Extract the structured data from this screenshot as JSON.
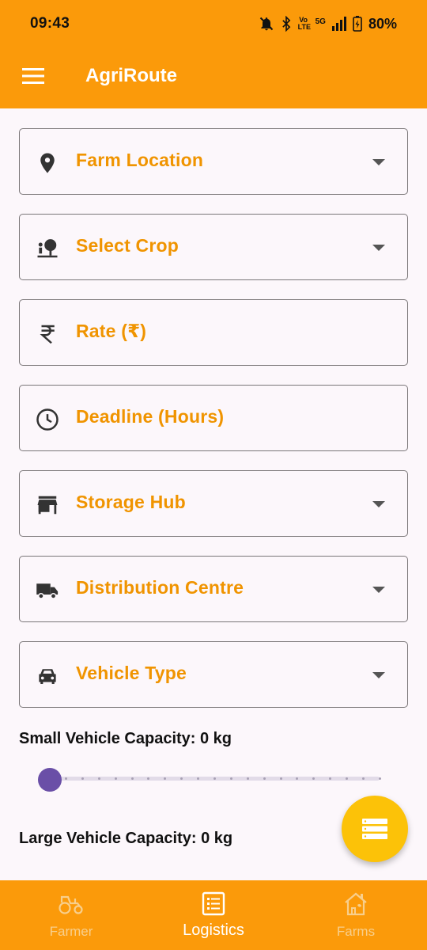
{
  "status_bar": {
    "time": "09:43",
    "network": "5G",
    "volte": "Vo LTE",
    "battery": "80%",
    "icons": [
      "mute-bell-icon",
      "bluetooth-icon",
      "volte-icon",
      "signal-icon",
      "battery-charging-icon"
    ]
  },
  "app_bar": {
    "title": "AgriRoute",
    "menu_icon": "menu-icon",
    "color": "#fb9a0a"
  },
  "form": {
    "fields": [
      {
        "label": "Farm Location",
        "icon": "location-pin-icon",
        "dropdown": true
      },
      {
        "label": "Select Crop",
        "icon": "crop-icon",
        "dropdown": true
      },
      {
        "label": "Rate (₹)",
        "icon": "rupee-icon",
        "dropdown": false
      },
      {
        "label": "Deadline (Hours)",
        "icon": "clock-icon",
        "dropdown": false
      },
      {
        "label": "Storage Hub",
        "icon": "store-icon",
        "dropdown": true
      },
      {
        "label": "Distribution Centre",
        "icon": "truck-icon",
        "dropdown": true
      },
      {
        "label": "Vehicle Type",
        "icon": "car-icon",
        "dropdown": true
      }
    ],
    "label_color": "#f09400"
  },
  "capacity": {
    "small_label": "Small Vehicle Capacity: 0 kg",
    "small_value": 0,
    "large_label": "Large Vehicle Capacity: 0 kg",
    "large_value": 0,
    "slider_color": "#6a4fa7"
  },
  "fab": {
    "icon": "list-stack-icon",
    "color": "#fcc208"
  },
  "bottom_nav": {
    "items": [
      {
        "label": "Farmer",
        "icon": "tractor-icon",
        "active": false
      },
      {
        "label": "Logistics",
        "icon": "list-icon",
        "active": true
      },
      {
        "label": "Farms",
        "icon": "farmhouse-icon",
        "active": false
      }
    ]
  }
}
